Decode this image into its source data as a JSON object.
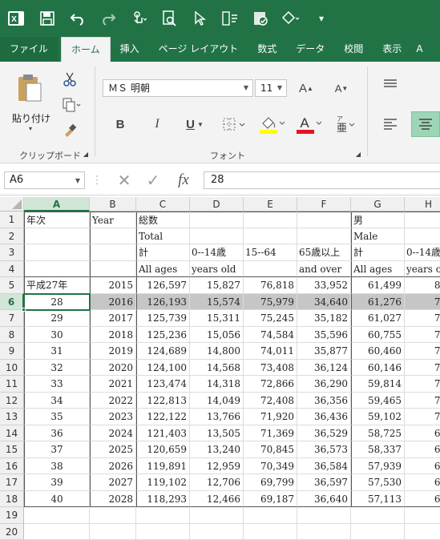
{
  "ribbon_tabs": [
    "ファイル",
    "ホーム",
    "挿入",
    "ページ レイアウト",
    "数式",
    "データ",
    "校閲",
    "表示"
  ],
  "font": {
    "name": "ＭＳ 明朝",
    "size": "11"
  },
  "clipboard": {
    "paste_label": "貼り付け",
    "group_label": "クリップボード"
  },
  "font_group_label": "フォント",
  "name_box": "A6",
  "formula_value": "28",
  "columns": [
    "A",
    "B",
    "C",
    "D",
    "E",
    "F",
    "G",
    "H"
  ],
  "selected_column": "A",
  "row_numbers": [
    "1",
    "2",
    "3",
    "4",
    "5",
    "6",
    "7",
    "8",
    "9",
    "10",
    "11",
    "12",
    "13",
    "14",
    "15",
    "16",
    "17",
    "18",
    "19",
    "20"
  ],
  "selected_row": "6",
  "header_rows": [
    [
      "年次",
      "Year",
      "総数",
      "",
      "",
      "",
      "男",
      ""
    ],
    [
      "",
      "",
      "Total",
      "",
      "",
      "",
      "Male",
      ""
    ],
    [
      "",
      "",
      "計",
      "0--14歳",
      "15--64",
      "65歳以上",
      "計",
      "0--14歳"
    ],
    [
      "",
      "",
      "All ages",
      "years old",
      "",
      "and over",
      "All ages",
      "years o"
    ]
  ],
  "data_rows": [
    [
      "平成27年",
      "2015",
      "126,597",
      "15,827",
      "76,818",
      "33,952",
      "61,499",
      "8,1"
    ],
    [
      "28",
      "2016",
      "126,193",
      "15,574",
      "75,979",
      "34,640",
      "61,276",
      "7,9"
    ],
    [
      "29",
      "2017",
      "125,739",
      "15,311",
      "75,245",
      "35,182",
      "61,027",
      "7,8"
    ],
    [
      "30",
      "2018",
      "125,236",
      "15,056",
      "74,584",
      "35,596",
      "60,755",
      "7,7"
    ],
    [
      "31",
      "2019",
      "124,689",
      "14,800",
      "74,011",
      "35,877",
      "60,460",
      "7,5"
    ],
    [
      "32",
      "2020",
      "124,100",
      "14,568",
      "73,408",
      "36,124",
      "60,146",
      "7,4"
    ],
    [
      "33",
      "2021",
      "123,474",
      "14,318",
      "72,866",
      "36,290",
      "59,814",
      "7,3"
    ],
    [
      "34",
      "2022",
      "122,813",
      "14,049",
      "72,408",
      "36,356",
      "59,465",
      "7,2"
    ],
    [
      "35",
      "2023",
      "122,122",
      "13,766",
      "71,920",
      "36,436",
      "59,102",
      "7,0"
    ],
    [
      "36",
      "2024",
      "121,403",
      "13,505",
      "71,369",
      "36,529",
      "58,725",
      "6,9"
    ],
    [
      "37",
      "2025",
      "120,659",
      "13,240",
      "70,845",
      "36,573",
      "58,337",
      "6,7"
    ],
    [
      "38",
      "2026",
      "119,891",
      "12,959",
      "70,349",
      "36,584",
      "57,939",
      "6,6"
    ],
    [
      "39",
      "2027",
      "119,102",
      "12,706",
      "69,799",
      "36,597",
      "57,530",
      "6,5"
    ],
    [
      "40",
      "2028",
      "118,293",
      "12,466",
      "69,187",
      "36,640",
      "57,113",
      "6,3"
    ]
  ],
  "colors": {
    "brand": "#217346",
    "selection_fill": "#c6c6c6",
    "font_color": "#e81123",
    "highlight": "#ffff00"
  }
}
